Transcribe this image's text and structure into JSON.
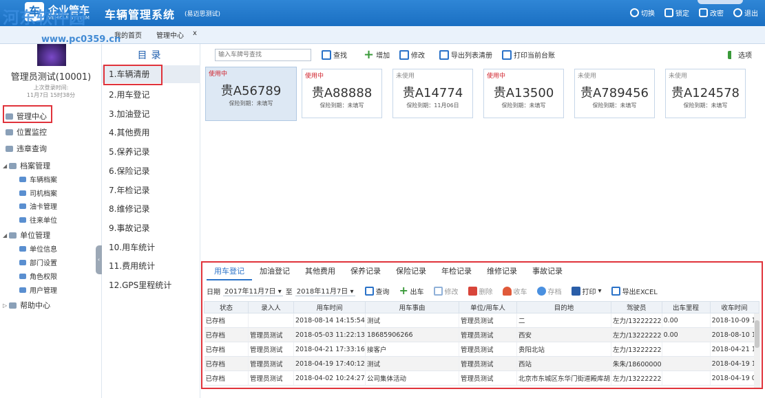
{
  "app": {
    "brand": "企业管车",
    "brand_sub": "VEHICLE SYSTEM",
    "title": "车辆管理系统",
    "subtitle": "(易迈思测试)",
    "watermark": "河东软件园",
    "watermark_url": "www.pc0359.cn"
  },
  "top_actions": {
    "switch": "切换",
    "lock": "锁定",
    "password": "改密",
    "exit": "退出"
  },
  "tabs": {
    "home": "我的首页",
    "mgmt": "管理中心",
    "close": "x"
  },
  "user": {
    "name": "管理员测试(10001)",
    "last_login_label": "上次登录时间:",
    "last_login_time": "11月7日 15时38分"
  },
  "nav": {
    "mgmt_center": "管理中心",
    "location": "位置监控",
    "violation": "违章查询",
    "archives": "档案管理",
    "vehicle_archive": "车辆档案",
    "driver_archive": "司机档案",
    "fuelcard": "油卡管理",
    "partner": "往来单位",
    "org": "单位管理",
    "org_info": "单位信息",
    "dept": "部门设置",
    "role": "角色权限",
    "users": "用户管理",
    "help": "帮助中心"
  },
  "directory": {
    "title": "目录",
    "items": [
      "1.车辆清册",
      "2.用车登记",
      "3.加油登记",
      "4.其他费用",
      "5.保养记录",
      "6.保险记录",
      "7.年检记录",
      "8.维修记录",
      "9.事故记录",
      "10.用车统计",
      "11.费用统计",
      "12.GPS里程统计"
    ]
  },
  "toolbar": {
    "search_placeholder": "输入车牌号查找",
    "query": "查找",
    "add": "增加",
    "edit": "修改",
    "export": "导出列表清册",
    "print": "打印当前台账",
    "options": "选项"
  },
  "cards": [
    {
      "status": "使用中",
      "used": true,
      "plate": "贵A56789",
      "insurance": "保险到期：未填写"
    },
    {
      "status": "使用中",
      "used": true,
      "plate": "贵A88888",
      "insurance": "保险到期：未填写"
    },
    {
      "status": "未使用",
      "used": false,
      "plate": "贵A14774",
      "insurance": "保险到期：11月06日"
    },
    {
      "status": "使用中",
      "used": true,
      "plate": "贵A13500",
      "insurance": "保险到期：未填写"
    },
    {
      "status": "未使用",
      "used": false,
      "plate": "贵A789456",
      "insurance": "保险到期：未填写"
    },
    {
      "status": "未使用",
      "used": false,
      "plate": "贵A124578",
      "insurance": "保险到期：未填写"
    }
  ],
  "bottom_tabs": [
    "用车登记",
    "加油登记",
    "其他费用",
    "保养记录",
    "保险记录",
    "年检记录",
    "维修记录",
    "事故记录"
  ],
  "filter": {
    "date_label": "日期",
    "from": "2017年11月7日",
    "to_label": "至",
    "to": "2018年11月7日",
    "query": "查询",
    "out": "出车",
    "edit": "修改",
    "delete": "删除",
    "return": "收车",
    "archive": "存档",
    "print": "打印",
    "export": "导出EXCEL"
  },
  "table": {
    "headers": [
      "状态",
      "录入人",
      "用车时间",
      "用车事由",
      "单位/用车人",
      "目的地",
      "驾驶员",
      "出车里程",
      "收车时间"
    ],
    "rows": [
      [
        "已存档",
        "",
        "2018-08-14 14:15:54",
        "测试",
        "管理员测试",
        "二",
        "左力/13222222",
        "0.00",
        "2018-10-09 1"
      ],
      [
        "已存档",
        "管理员测试",
        "2018-05-03 11:22:13",
        "18685906266",
        "管理员测试",
        "西安",
        "左力/13222222",
        "0.00",
        "2018-08-10 1"
      ],
      [
        "已存档",
        "管理员测试",
        "2018-04-21 17:33:16",
        "接客户",
        "管理员测试",
        "贵阳北站",
        "左力/13222222",
        "",
        "2018-04-21 1"
      ],
      [
        "已存档",
        "管理员测试",
        "2018-04-19 17:40:12",
        "测试",
        "管理员测试",
        "西站",
        "朱朱/18600000",
        "",
        "2018-04-19 1"
      ],
      [
        "已存档",
        "管理员测试",
        "2018-04-02 10:24:27",
        "公司集体活动",
        "管理员测试",
        "北京市东城区东华门街道殿库胡",
        "左力/13222222",
        "",
        "2018-04-19 0"
      ]
    ]
  }
}
